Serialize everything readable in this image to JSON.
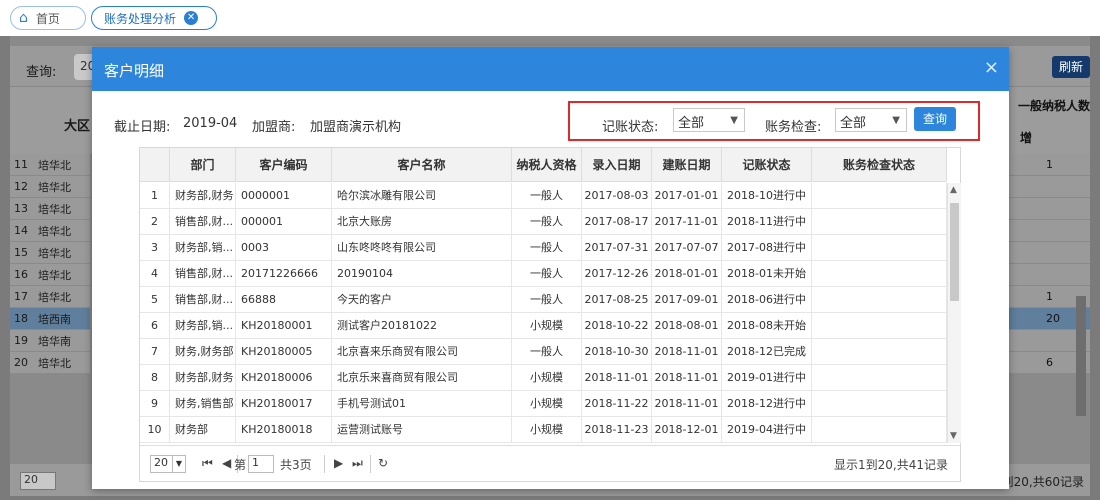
{
  "tabs": {
    "home": "首页",
    "active": "账务处理分析"
  },
  "background": {
    "query_label": "查询:",
    "query_value": "20",
    "refresh": "刷新",
    "col_region": "大区",
    "col_taxpayer": "一般纳税人数",
    "col_new": "增",
    "rows": [
      {
        "n": "11",
        "t": "培华北",
        "v": "1"
      },
      {
        "n": "12",
        "t": "培华北",
        "v": ""
      },
      {
        "n": "13",
        "t": "培华北",
        "v": ""
      },
      {
        "n": "14",
        "t": "培华北",
        "v": ""
      },
      {
        "n": "15",
        "t": "培华北",
        "v": ""
      },
      {
        "n": "16",
        "t": "培华北",
        "v": ""
      },
      {
        "n": "17",
        "t": "培华北",
        "v": "1"
      },
      {
        "n": "18",
        "t": "培西南",
        "v": "20"
      },
      {
        "n": "19",
        "t": "培华南",
        "v": ""
      },
      {
        "n": "20",
        "t": "培华北",
        "v": "6"
      }
    ],
    "footer_page_size": "20",
    "footer_info": "到20,共60记录"
  },
  "modal": {
    "title": "客户明细",
    "close": "×",
    "cutoff_label": "截止日期:",
    "cutoff_value": "2019-04",
    "franchise_label": "加盟商:",
    "franchise_value": "加盟商演示机构",
    "bookkeeping_label": "记账状态:",
    "bookkeeping_value": "全部",
    "check_label": "账务检查:",
    "check_value": "全部",
    "query_button": "查询"
  },
  "table": {
    "columns": [
      "",
      "部门",
      "客户编码",
      "客户名称",
      "纳税人资格",
      "录入日期",
      "建账日期",
      "记账状态",
      "账务检查状态"
    ],
    "rows": [
      [
        "1",
        "财务部,财务",
        "0000001",
        "哈尔滨冰雕有限公司",
        "一般人",
        "2017-08-03",
        "2017-01-01",
        "2018-10进行中",
        ""
      ],
      [
        "2",
        "销售部,财...",
        "000001",
        "北京大账房",
        "一般人",
        "2017-08-17",
        "2017-11-01",
        "2018-11进行中",
        ""
      ],
      [
        "3",
        "财务部,销...",
        "0003",
        "山东咚咚咚有限公司",
        "一般人",
        "2017-07-31",
        "2017-07-07",
        "2017-08进行中",
        ""
      ],
      [
        "4",
        "销售部,财...",
        "20171226666",
        "20190104",
        "一般人",
        "2017-12-26",
        "2018-01-01",
        "2018-01未开始",
        ""
      ],
      [
        "5",
        "销售部,财...",
        "66888",
        "今天的客户",
        "一般人",
        "2017-08-25",
        "2017-09-01",
        "2018-06进行中",
        ""
      ],
      [
        "6",
        "财务部,销...",
        "KH20180001",
        "测试客户20181022",
        "小规模",
        "2018-10-22",
        "2018-08-01",
        "2018-08未开始",
        ""
      ],
      [
        "7",
        "财务,财务部",
        "KH20180005",
        "北京喜来乐商贸有限公司",
        "一般人",
        "2018-10-30",
        "2018-11-01",
        "2018-12已完成",
        ""
      ],
      [
        "8",
        "财务部,财务",
        "KH20180006",
        "北京乐来喜商贸有限公司",
        "小规模",
        "2018-11-01",
        "2018-11-01",
        "2019-01进行中",
        ""
      ],
      [
        "9",
        "财务,销售部",
        "KH20180017",
        "手机号测试01",
        "小规模",
        "2018-11-22",
        "2018-11-01",
        "2018-12进行中",
        ""
      ],
      [
        "10",
        "财务部",
        "KH20180018",
        "运营测试账号",
        "小规模",
        "2018-11-23",
        "2018-12-01",
        "2019-04进行中",
        ""
      ]
    ]
  },
  "pager": {
    "page_size": "20",
    "page_prefix": "第",
    "page_value": "1",
    "page_total": "共3页",
    "info": "显示1到20,共41记录"
  }
}
